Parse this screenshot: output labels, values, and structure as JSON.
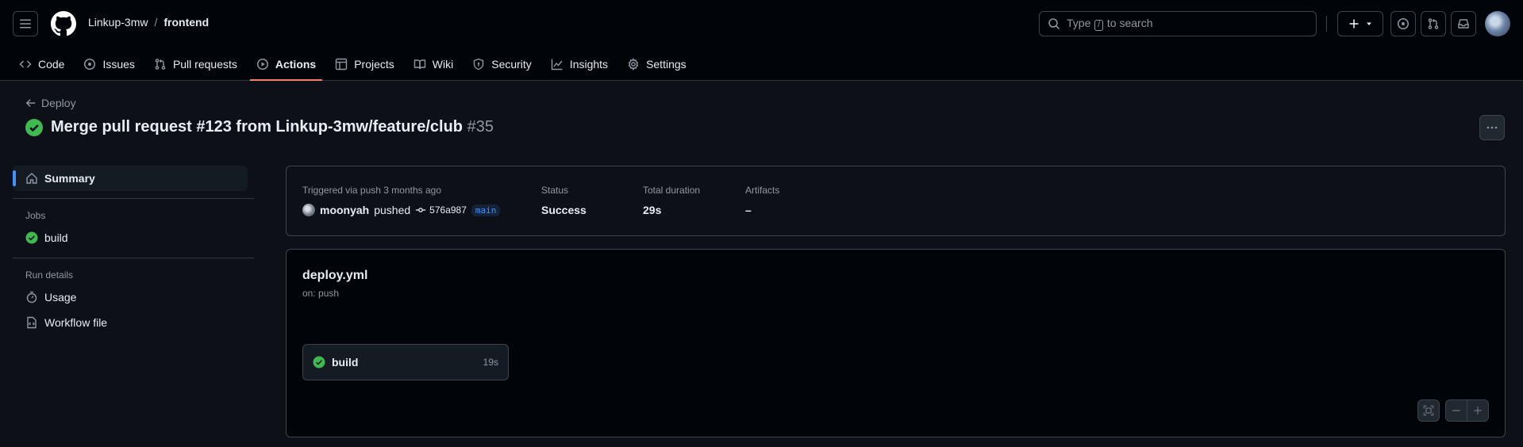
{
  "header": {
    "owner": "Linkup-3mw",
    "separator": "/",
    "repo": "frontend",
    "search_prefix": "Type",
    "search_key": "/",
    "search_suffix": "to search"
  },
  "tabs": [
    {
      "label": "Code",
      "icon": "code-icon"
    },
    {
      "label": "Issues",
      "icon": "issue-opened-icon"
    },
    {
      "label": "Pull requests",
      "icon": "git-pull-request-icon"
    },
    {
      "label": "Actions",
      "icon": "play-icon",
      "active": true
    },
    {
      "label": "Projects",
      "icon": "table-icon"
    },
    {
      "label": "Wiki",
      "icon": "book-icon"
    },
    {
      "label": "Security",
      "icon": "shield-icon"
    },
    {
      "label": "Insights",
      "icon": "graph-icon"
    },
    {
      "label": "Settings",
      "icon": "gear-icon"
    }
  ],
  "run": {
    "back_label": "Deploy",
    "title": "Merge pull request #123 from Linkup-3mw/feature/club",
    "number": "#35"
  },
  "sidebar": {
    "summary": "Summary",
    "jobs_heading": "Jobs",
    "job": "build",
    "details_heading": "Run details",
    "usage": "Usage",
    "workflow_file": "Workflow file"
  },
  "summary": {
    "trigger_label": "Triggered via push 3 months ago",
    "actor": "moonyah",
    "action": "pushed",
    "sha": "576a987",
    "branch": "main",
    "status_label": "Status",
    "status_value": "Success",
    "duration_label": "Total duration",
    "duration_value": "29s",
    "artifacts_label": "Artifacts",
    "artifacts_value": "–"
  },
  "graph": {
    "workflow_file": "deploy.yml",
    "trigger": "on: push",
    "job_name": "build",
    "job_duration": "19s"
  },
  "colors": {
    "success": "#3fb950",
    "accent_tab": "#f78166",
    "link": "#4493f8"
  }
}
